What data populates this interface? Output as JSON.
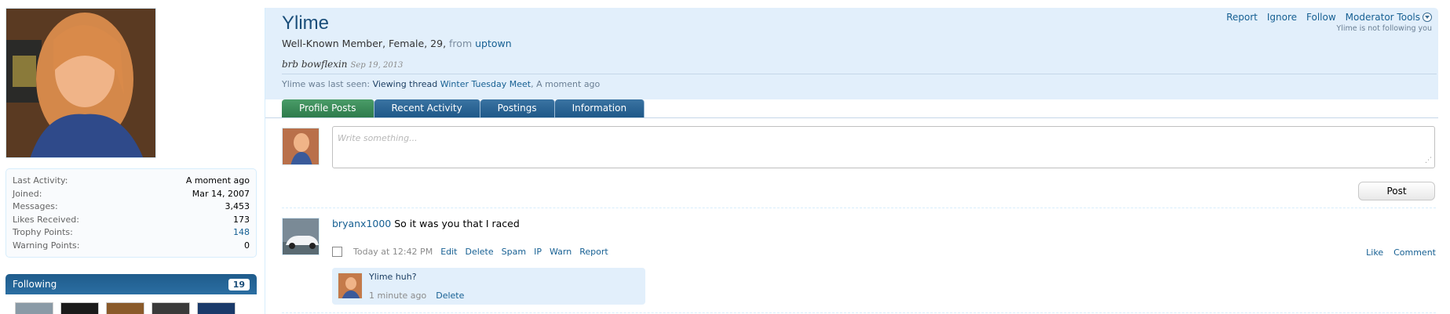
{
  "stats": [
    {
      "label": "Last Activity:",
      "value": "A moment ago",
      "link": false
    },
    {
      "label": "Joined:",
      "value": "Mar 14, 2007",
      "link": false
    },
    {
      "label": "Messages:",
      "value": "3,453",
      "link": false
    },
    {
      "label": "Likes Received:",
      "value": "173",
      "link": false
    },
    {
      "label": "Trophy Points:",
      "value": "148",
      "link": true
    },
    {
      "label": "Warning Points:",
      "value": "0",
      "link": false
    }
  ],
  "following": {
    "title": "Following",
    "count": "19"
  },
  "header": {
    "name": "Ylime",
    "info_main": "Well-Known Member, Female, 29,",
    "info_from": "from",
    "location": "uptown",
    "status_text": "brb bowflexin",
    "status_date": "Sep 19, 2013",
    "last_seen_prefix": "Ylime was last seen:",
    "last_seen_action": "Viewing thread",
    "last_seen_thread": "Winter Tuesday Meet",
    "last_seen_time": ", A moment ago",
    "links": {
      "report": "Report",
      "ignore": "Ignore",
      "follow": "Follow",
      "moderator_tools": "Moderator Tools"
    },
    "not_following": "Ylime is not following you"
  },
  "tabs": [
    {
      "label": "Profile Posts",
      "active": true
    },
    {
      "label": "Recent Activity",
      "active": false
    },
    {
      "label": "Postings",
      "active": false
    },
    {
      "label": "Information",
      "active": false
    }
  ],
  "composer": {
    "placeholder": "Write something...",
    "post_label": "Post"
  },
  "message": {
    "poster": "bryanx1000",
    "text": "So it was you that I raced",
    "time": "Today at 12:42 PM",
    "actions": [
      "Edit",
      "Delete",
      "Spam",
      "IP",
      "Warn",
      "Report"
    ],
    "right_actions": [
      "Like",
      "Comment"
    ]
  },
  "comment": {
    "text": "Ylime huh?",
    "time": "1 minute ago",
    "delete_label": "Delete"
  },
  "colors": {
    "accent": "#176093",
    "header_bg": "#e2effb",
    "active_tab": "#2e7b4b",
    "tab": "#1f5888"
  }
}
